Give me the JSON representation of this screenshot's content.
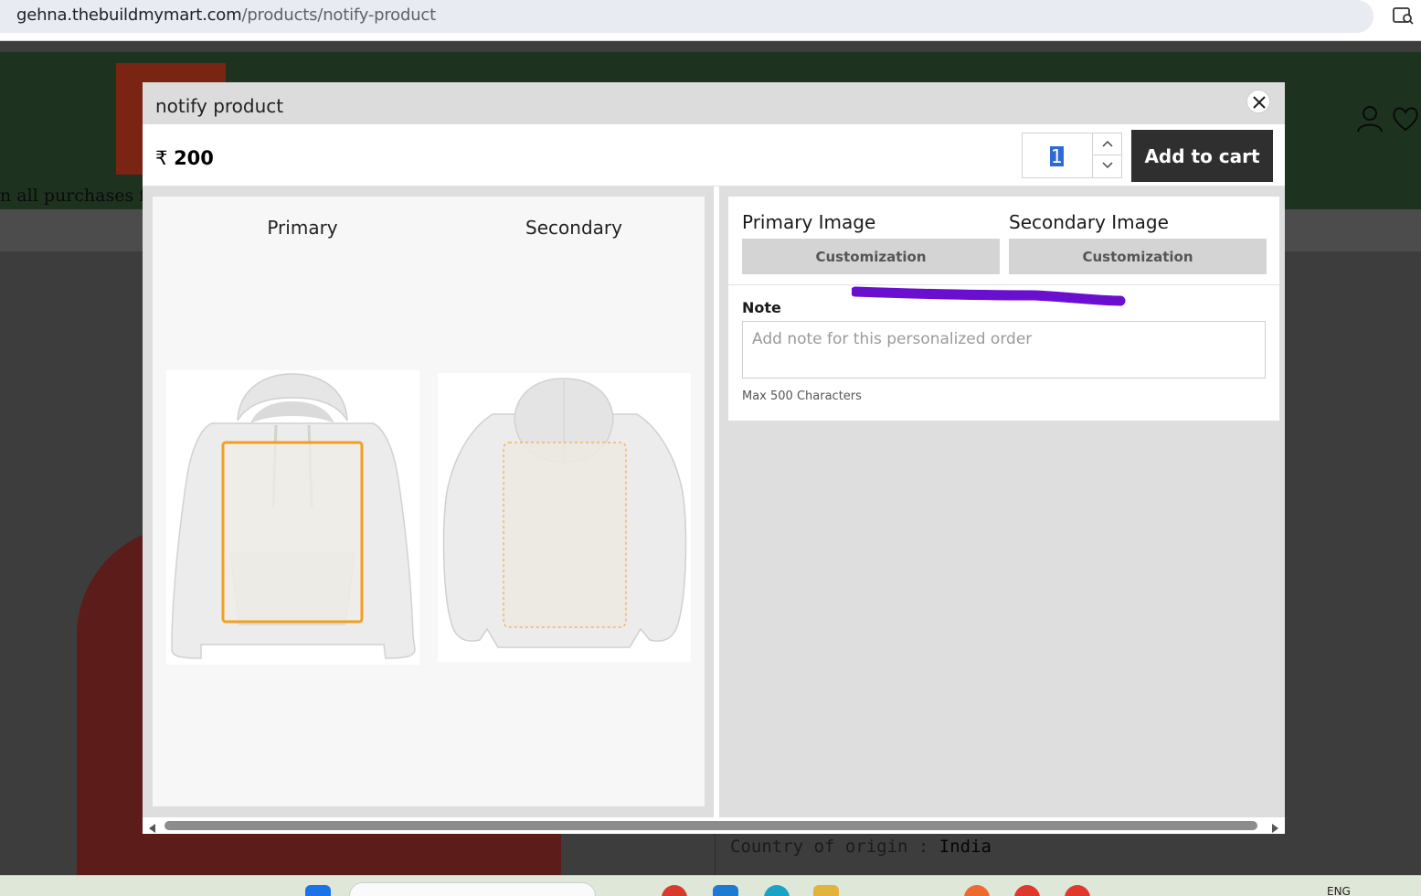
{
  "browser": {
    "url_domain": "gehna.thebuildmymart.com",
    "url_path": "/products/notify-product"
  },
  "background_page": {
    "promo_text": "n all purchases fo",
    "origin_label": "Country of origin : ",
    "origin_value": "India"
  },
  "modal": {
    "title": "notify product",
    "price_currency": "₹",
    "price_amount": "200",
    "quantity": "1",
    "add_to_cart_label": "Add to cart",
    "preview": {
      "primary_label": "Primary",
      "secondary_label": "Secondary"
    },
    "customization": {
      "primary_heading": "Primary Image",
      "secondary_heading": "Secondary Image",
      "primary_button": "Customization",
      "secondary_button": "Customization",
      "note_label": "Note",
      "note_placeholder": "Add note for this personalized order",
      "note_hint": "Max 500 Characters"
    }
  },
  "taskbar": {
    "language": "ENG"
  },
  "colors": {
    "header_green": "#1d3320",
    "add_to_cart_bg": "#2f2f2f",
    "print_area_orange": "#f0a020",
    "annotation_purple": "#6a0fd0",
    "selection_blue": "#2c6bd6"
  },
  "icons": [
    "tab-search-icon",
    "user-icon",
    "heart-icon",
    "close-icon",
    "chevron-up-icon",
    "chevron-down-icon",
    "scroll-left-icon",
    "scroll-right-icon"
  ]
}
